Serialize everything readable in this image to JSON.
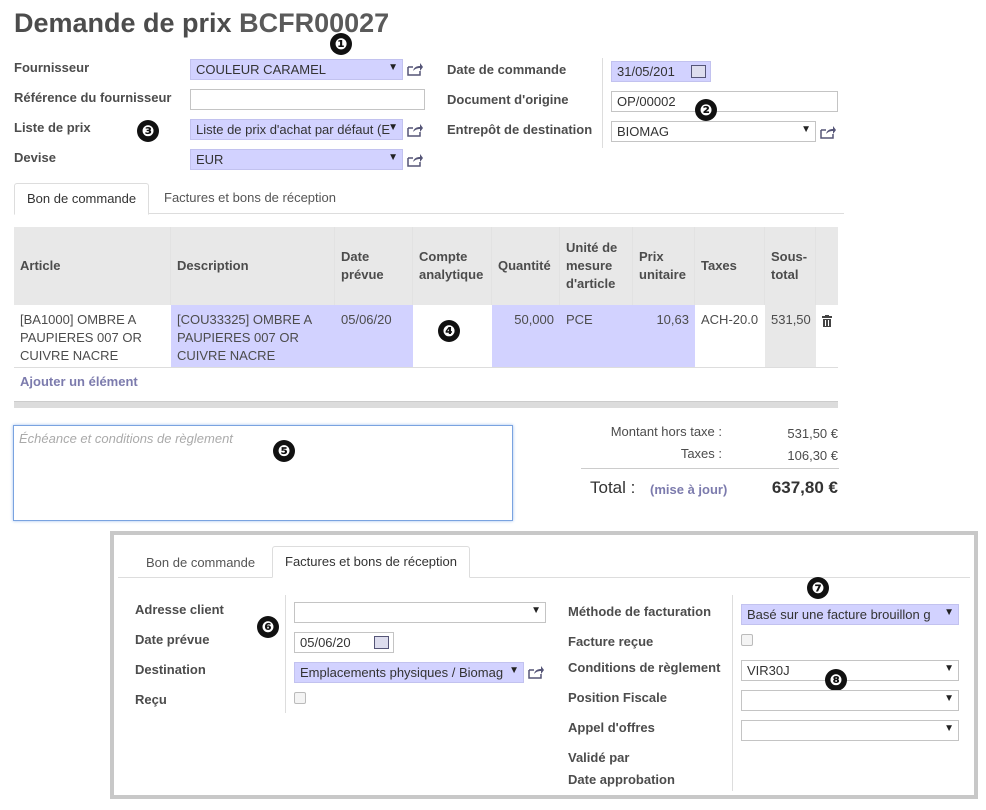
{
  "header": {
    "title_prefix": "Demande de prix",
    "reference": "BCFR00027"
  },
  "form": {
    "supplier_label": "Fournisseur",
    "supplier_value": "COULEUR CARAMEL",
    "supplier_ref_label": "Référence du fournisseur",
    "supplier_ref_value": "",
    "pricelist_label": "Liste de prix",
    "pricelist_value": "Liste de prix d'achat par défaut (E",
    "currency_label": "Devise",
    "currency_value": "EUR",
    "order_date_label": "Date de commande",
    "order_date_value": "31/05/201",
    "origin_label": "Document d'origine",
    "origin_value": "OP/00002",
    "warehouse_label": "Entrepôt de destination",
    "warehouse_value": "BIOMAG"
  },
  "tabs": [
    "Bon de commande",
    "Factures et bons de réception"
  ],
  "table": {
    "columns": [
      "Article",
      "Description",
      "Date prévue",
      "Compte analytique",
      "Quantité",
      "Unité de mesure d'article",
      "Prix unitaire",
      "Taxes",
      "Sous-total"
    ],
    "rows": [
      {
        "article": "[BA1000] OMBRE A PAUPIERES 007 OR CUIVRE NACRE",
        "description": "[COU33325] OMBRE A PAUPIERES 007 OR CUIVRE NACRE",
        "date": "05/06/20",
        "account": "",
        "quantity": "50,000",
        "uom": "PCE",
        "price": "10,63",
        "taxes": "ACH-20.0",
        "subtotal": "531,50"
      }
    ],
    "add_item": "Ajouter un élément"
  },
  "notes_placeholder": "Échéance et conditions de règlement",
  "totals": {
    "untaxed_label": "Montant hors taxe :",
    "untaxed_value": "531,50 €",
    "taxes_label": "Taxes :",
    "taxes_value": "106,30 €",
    "total_label": "Total :",
    "update_link": "(mise à jour)",
    "total_value": "637,80 €"
  },
  "inset": {
    "tabs": [
      "Bon de commande",
      "Factures et bons de réception"
    ],
    "customer_address_label": "Adresse client",
    "customer_address_value": "",
    "expected_date_label": "Date prévue",
    "expected_date_value": "05/06/20",
    "destination_label": "Destination",
    "destination_value": "Emplacements physiques / Biomag",
    "received_label": "Reçu",
    "invoice_method_label": "Méthode de facturation",
    "invoice_method_value": "Basé sur une facture brouillon g",
    "invoice_received_label": "Facture reçue",
    "payment_terms_label": "Conditions de règlement",
    "payment_terms_value": "VIR30J",
    "fiscal_position_label": "Position Fiscale",
    "fiscal_position_value": "",
    "tender_label": "Appel d'offres",
    "tender_value": "",
    "validated_by_label": "Validé par",
    "approval_date_label": "Date approbation"
  },
  "callouts": [
    "❶",
    "❷",
    "❸",
    "❹",
    "❺",
    "❻",
    "❼",
    "❽"
  ],
  "icons": {
    "external": "external-link-icon",
    "calendar": "calendar-icon",
    "trash": "trash-icon",
    "dropdown": "chevron-down-icon"
  },
  "colors": {
    "required_field": "#d2d2ff",
    "link": "#7c7bad",
    "header_bg": "#e8e8e8"
  }
}
